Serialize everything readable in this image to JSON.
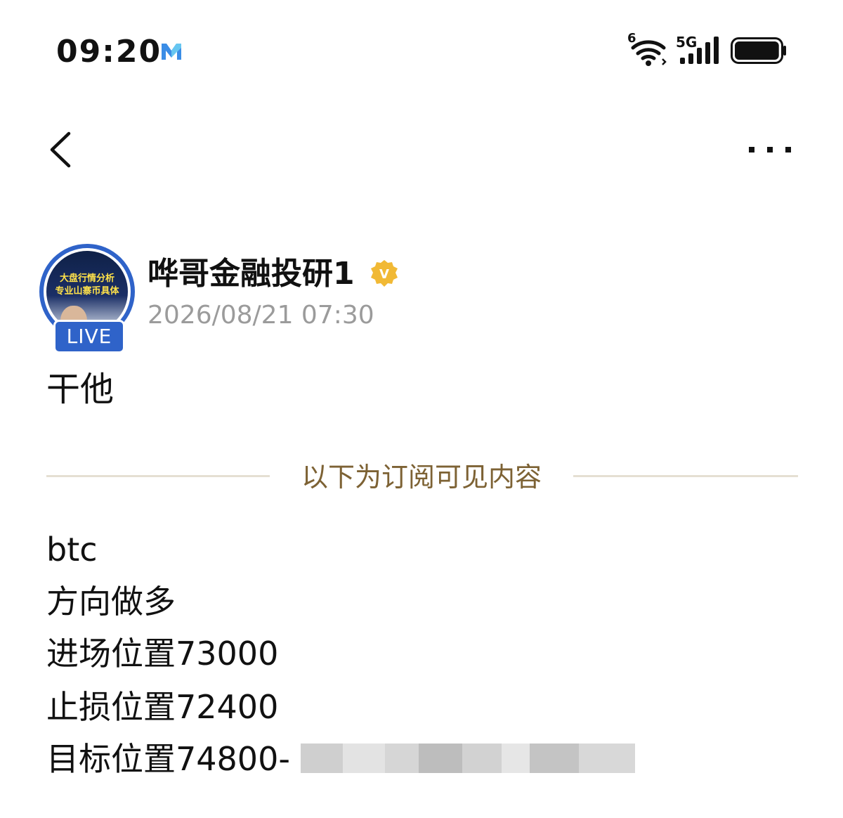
{
  "status_bar": {
    "time": "09:20",
    "app_icon": "m-app-icon",
    "wifi_badge": "6",
    "network": "5G",
    "battery_level": 0.95
  },
  "nav": {
    "back_icon": "chevron-left-icon",
    "more_icon": "more-dots-icon"
  },
  "author": {
    "name": "哗哥金融投研1",
    "verified_badge": "V",
    "timestamp": "2026/08/21 07:30",
    "live_label": "LIVE",
    "avatar_text_line1": "大盘行情分析",
    "avatar_text_line2": "专业山寨币具体"
  },
  "post": {
    "title": "干他",
    "divider_label": "以下为订阅可见内容",
    "lines": [
      "btc",
      "方向做多",
      "进场位置73000",
      "止损位置72400",
      "目标位置74800-"
    ]
  },
  "colors": {
    "accent_blue": "#2f63c9",
    "divider_text": "#7d6234",
    "timestamp_gray": "#9b9b9b",
    "verified_gold": "#f1b935"
  }
}
